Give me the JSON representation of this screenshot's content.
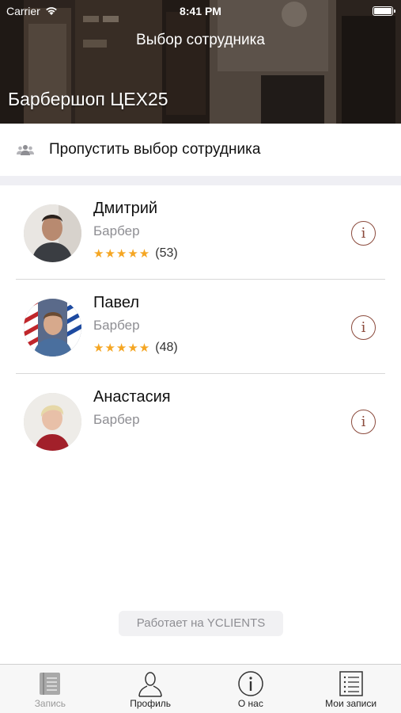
{
  "status_bar": {
    "carrier": "Carrier",
    "time": "8:41 PM",
    "battery_level": 1.0
  },
  "header": {
    "nav_title": "Выбор сотрудника",
    "shop_title": "Барбершоп ЦЕХ25"
  },
  "skip": {
    "label": "Пропустить выбор сотрудника",
    "icon": "group-icon"
  },
  "staff": [
    {
      "name": "Дмитрий",
      "role": "Барбер",
      "stars": "★★★★★",
      "rating": 5,
      "reviews": "(53)",
      "avatar": "avatar-dmitry"
    },
    {
      "name": "Павел",
      "role": "Барбер",
      "stars": "★★★★★",
      "rating": 5,
      "reviews": "(48)",
      "avatar": "avatar-pavel"
    },
    {
      "name": "Анастасия",
      "role": "Барбер",
      "avatar": "avatar-anastasia"
    }
  ],
  "info_icon_glyph": "i",
  "powered_by": "Работает на YCLIENTS",
  "tab_bar": {
    "tabs": [
      {
        "label": "Запись",
        "icon": "book-icon",
        "enabled": false
      },
      {
        "label": "Профиль",
        "icon": "person-icon",
        "enabled": true
      },
      {
        "label": "О нас",
        "icon": "info-icon",
        "enabled": true
      },
      {
        "label": "Мои записи",
        "icon": "list-icon",
        "enabled": true
      }
    ]
  },
  "colors": {
    "accent": "#8b4a3c",
    "star": "#f5a623",
    "secondary_text": "#8e8e93",
    "separator": "#efeff4"
  }
}
